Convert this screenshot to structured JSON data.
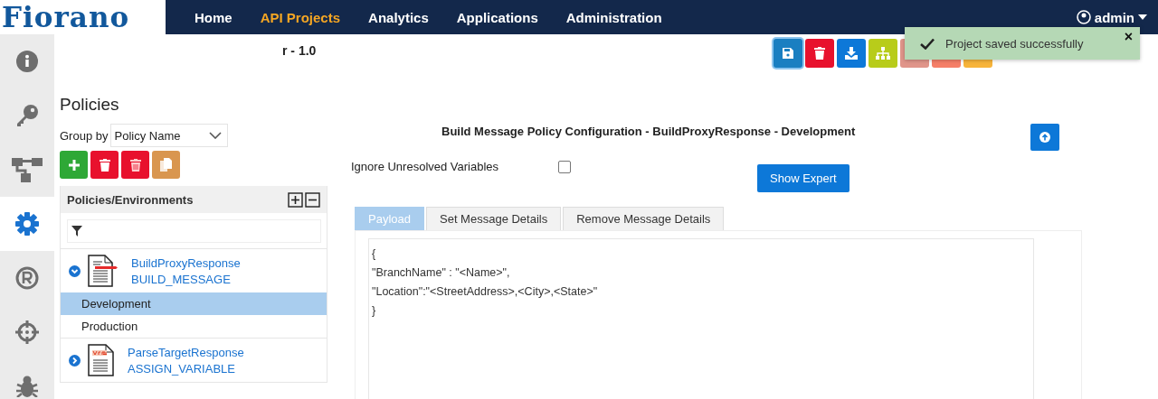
{
  "logo": {
    "text": "Fiorano"
  },
  "nav": [
    {
      "label": "Home",
      "selected": false
    },
    {
      "label": "API Projects",
      "selected": true
    },
    {
      "label": "Analytics",
      "selected": false
    },
    {
      "label": "Applications",
      "selected": false
    },
    {
      "label": "Administration",
      "selected": false
    }
  ],
  "user": {
    "name": "admin"
  },
  "sidebar": [
    {
      "kind": "info",
      "selected": false
    },
    {
      "kind": "key",
      "selected": false
    },
    {
      "kind": "flow",
      "selected": false
    },
    {
      "kind": "gear",
      "selected": true
    },
    {
      "kind": "registered",
      "selected": false
    },
    {
      "kind": "target",
      "selected": false
    },
    {
      "kind": "bug",
      "selected": false
    }
  ],
  "revision": "r - 1.0",
  "toolbar": [
    {
      "kind": "save",
      "color": "#1a7fc1",
      "selected": true
    },
    {
      "kind": "delete",
      "color": "#e8112d",
      "selected": false
    },
    {
      "kind": "download",
      "color": "#0d78d8",
      "selected": false
    },
    {
      "kind": "tree",
      "color": "#b8cc1a",
      "selected": false
    },
    {
      "kind": "blank",
      "color": "#e0958a",
      "selected": false
    },
    {
      "kind": "blank",
      "color": "#f57f68",
      "selected": false
    },
    {
      "kind": "blank",
      "color": "#f7b43a",
      "selected": false
    }
  ],
  "toast": {
    "message": "Project saved successfully",
    "close": "×"
  },
  "policies": {
    "title": "Policies",
    "group_by_label": "Group by",
    "group_by_value": "Policy Name",
    "actions": [
      {
        "kind": "add",
        "color": "#2ea836"
      },
      {
        "kind": "delete",
        "color": "#e8112d"
      },
      {
        "kind": "delete-all",
        "color": "#e8112d"
      },
      {
        "kind": "copy",
        "color": "#d9964f"
      }
    ],
    "tree_header": "Policies/Environments",
    "items": [
      {
        "name": "BuildProxyResponse",
        "type": "BUILD_MESSAGE",
        "kind": "build",
        "expanded": true,
        "children": [
          {
            "name": "Development",
            "selected": true
          },
          {
            "name": "Production",
            "selected": false
          }
        ]
      },
      {
        "name": "ParseTargetResponse",
        "type": "ASSIGN_VARIABLE",
        "kind": "variable",
        "expanded": false
      }
    ]
  },
  "config": {
    "title": "Build Message Policy Configuration - BuildProxyResponse - Development",
    "ignore_label": "Ignore Unresolved Variables",
    "ignore_checked": false,
    "expert_button": "Show Expert",
    "tabs": [
      {
        "label": "Payload",
        "selected": true
      },
      {
        "label": "Set Message Details",
        "selected": false
      },
      {
        "label": "Remove Message Details",
        "selected": false
      }
    ],
    "payload": [
      "{",
      "\"BranchName\" : \"<Name>\",",
      "\"Location\":\"<StreetAddress>,<City>,<State>\"",
      "}"
    ]
  }
}
